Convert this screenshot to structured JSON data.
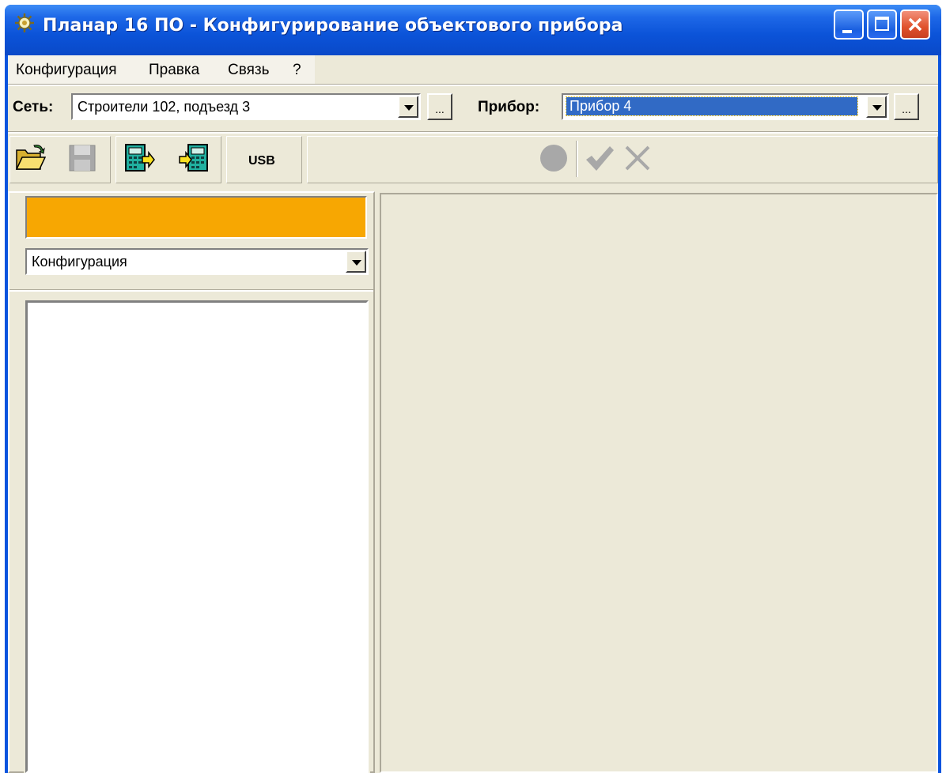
{
  "window": {
    "title": "Планар 16 ПО - Конфигурирование объектового прибора"
  },
  "menu": {
    "items": [
      "Конфигурация",
      "Правка",
      "Связь",
      "?"
    ]
  },
  "network": {
    "label": "Сеть:",
    "value": "Строители 102, подъезд 3",
    "browse_label": "..."
  },
  "device": {
    "label": "Прибор:",
    "value": "Прибор 4",
    "browse_label": "..."
  },
  "toolbar": {
    "usb_label": "USB",
    "icons": [
      "open-folder-icon",
      "save-icon",
      "read-device-icon",
      "write-device-icon",
      "record-icon",
      "apply-check-icon",
      "cancel-x-icon"
    ]
  },
  "left_panel": {
    "status_color": "#f7a702",
    "selector_value": "Конфигурация"
  },
  "colors": {
    "title_bar": "#0a54de",
    "client_bg": "#ece9d8",
    "selection": "#316ac5"
  }
}
